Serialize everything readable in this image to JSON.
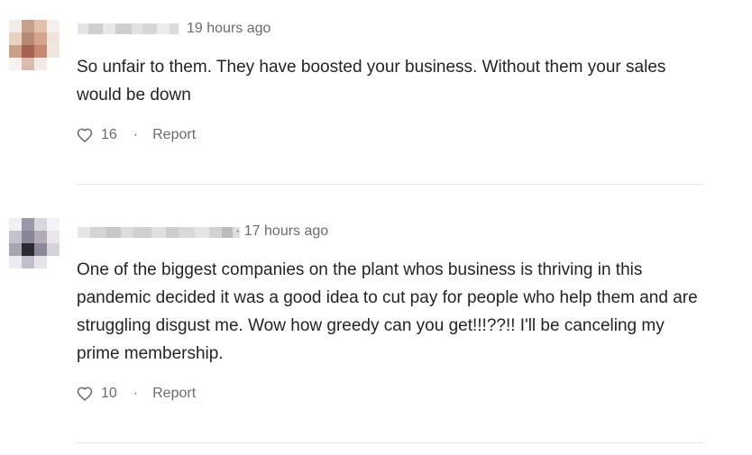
{
  "comments": [
    {
      "timestamp": "19 hours ago",
      "text": "So unfair to them. They have boosted your business. Without them your sales would be down",
      "likes": "16",
      "report_label": "Report",
      "separator": "·",
      "avatar_colors": [
        "#f2ece8",
        "#c8a08c",
        "#e2c0ac",
        "#f5f0ec",
        "#e8d2c4",
        "#b88a74",
        "#d6a48c",
        "#efe4dc",
        "#c9a088",
        "#a86050",
        "#c88870",
        "#f0e6de",
        "#f6f2ef",
        "#d9bcae",
        "#f3ebe5",
        "#ffffff"
      ],
      "name_blur_colors": [
        "#e4e4e4",
        "#d0d0d0",
        "#e8e8e8",
        "#cfcfcf",
        "#e2e2e2",
        "#d6d6d6",
        "#ececec",
        "#dadada"
      ]
    },
    {
      "timestamp": "· 17 hours ago",
      "text": "One of the biggest companies on the plant whos business is thriving in this pandemic decided it was a good idea to cut pay for people who help them and are struggling disgust me. Wow how greedy can you get!!!??!! I'll be canceling my prime membership.",
      "likes": "10",
      "report_label": "Report",
      "separator": "·",
      "avatar_colors": [
        "#f0f0f2",
        "#9a98a8",
        "#d8d6de",
        "#f4f4f6",
        "#c4c2cc",
        "#8a8696",
        "#b0acb8",
        "#e8e6ec",
        "#a8a4b0",
        "#2a2830",
        "#8c8898",
        "#d4d2da",
        "#ecebef",
        "#c0bec8",
        "#e6e4ea",
        "#ffffff"
      ],
      "name_blur_colors": [
        "#e6e6e6",
        "#d4d4d4",
        "#c8c8c8",
        "#dcdcdc",
        "#d0d0d0",
        "#e0e0e0",
        "#cccccc",
        "#d8d8d8",
        "#e4e4e4",
        "#d2d2d2",
        "#bcbcbc",
        "#dedede"
      ]
    }
  ]
}
